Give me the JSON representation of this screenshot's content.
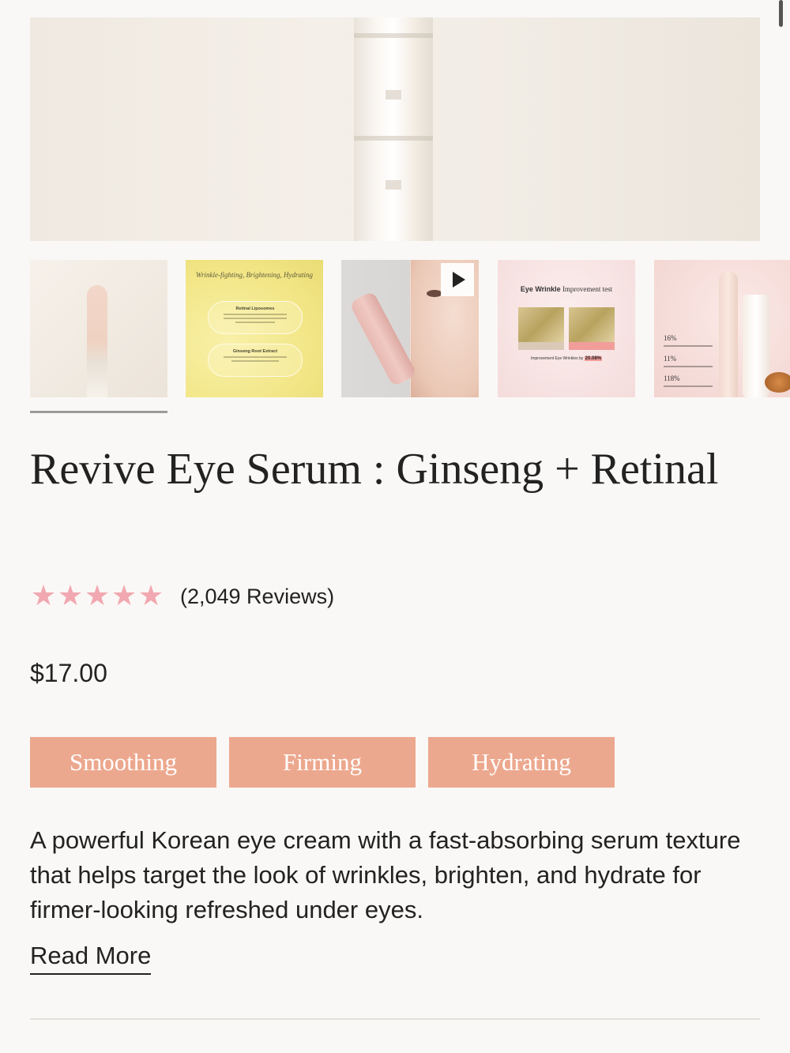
{
  "gallery": {
    "thumbnails": [
      {
        "kind": "image",
        "name": "product-bottle"
      },
      {
        "kind": "image",
        "name": "ingredients-card",
        "heading": "Wrinkle-fighting, Brightening, Hydrating",
        "items": [
          "Retinal Liposomes",
          "Ginseng Root Extract"
        ]
      },
      {
        "kind": "video",
        "name": "application-video",
        "icon": "play-icon"
      },
      {
        "kind": "image",
        "name": "clinical-test",
        "heading_bold": "Eye Wrinkle",
        "heading_rest": " Improvement test",
        "caption": "Improvement Eye Wrinkles by",
        "caption_value": "20.08%"
      },
      {
        "kind": "image",
        "name": "results-stats",
        "stats": [
          "16%",
          "11%",
          "118%"
        ]
      }
    ],
    "selected_index": 0
  },
  "product": {
    "title": "Revive Eye Serum : Ginseng + Retinal",
    "rating": 5,
    "review_count": "(2,049 Reviews)",
    "price": "$17.00",
    "tags": [
      "Smoothing",
      "Firming",
      "Hydrating"
    ],
    "description": "A powerful Korean eye cream with a fast-absorbing serum texture that helps target the look of wrinkles, brighten, and hydrate for firmer-looking refreshed under eyes.",
    "read_more": "Read More"
  },
  "colors": {
    "tag_bg": "#eca88e",
    "star": "#f1a8b0",
    "background": "#faf8f6"
  }
}
